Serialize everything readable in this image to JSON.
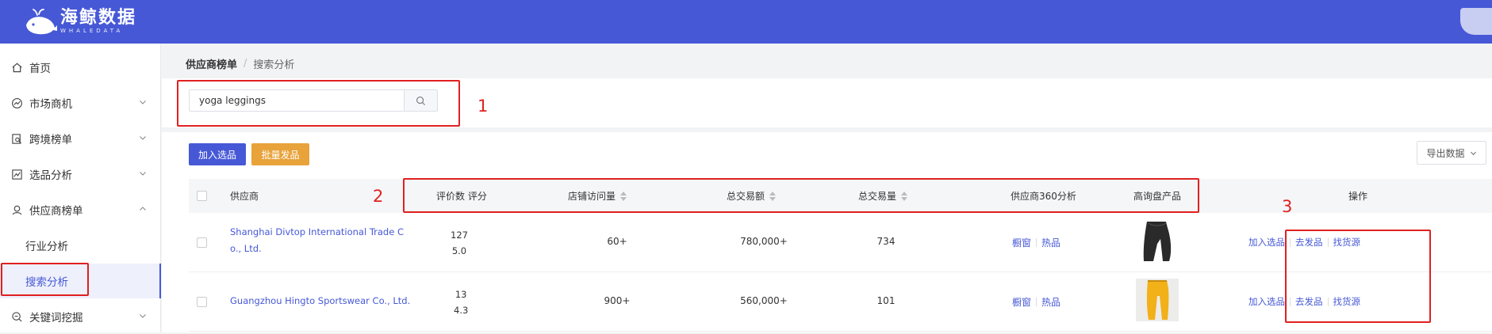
{
  "header": {
    "brand_cn": "海鲸数据",
    "brand_en": "WHALEDATA",
    "brand_color": "#4658d6"
  },
  "sidebar": {
    "items": [
      {
        "label": "首页",
        "icon": "home-icon"
      },
      {
        "label": "市场商机",
        "icon": "trend-icon"
      },
      {
        "label": "跨境榜单",
        "icon": "search-doc-icon"
      },
      {
        "label": "选品分析",
        "icon": "chart-icon"
      },
      {
        "label": "供应商榜单",
        "icon": "supplier-icon"
      },
      {
        "label": "行业分析"
      },
      {
        "label": "搜索分析"
      },
      {
        "label": "关键词挖掘",
        "icon": "keyword-icon"
      }
    ]
  },
  "breadcrumb": {
    "parent": "供应商榜单",
    "separator": "/",
    "current": "搜索分析"
  },
  "search": {
    "value": "yoga leggings"
  },
  "toolbar": {
    "add_label": "加入选品",
    "batch_label": "批量发品",
    "export_label": "导出数据"
  },
  "table": {
    "headers": {
      "supplier": "供应商",
      "reviews": "评价数 评分",
      "visits": "店铺访问量",
      "amount": "总交易额",
      "volume": "总交易量",
      "analysis360": "供应商360分析",
      "products": "高询盘产品",
      "actions": "操作"
    },
    "rows": [
      {
        "supplier_line1": "Shanghai Divtop International Trade C",
        "supplier_line2": "o., Ltd.",
        "reviews": "127",
        "rating": "5.0",
        "visits": "60+",
        "amount": "780,000+",
        "volume": "734",
        "window": "橱窗",
        "hot": "热品",
        "action_add": "加入选品",
        "action_publish": "去发品",
        "action_source": "找货源",
        "thumb_color": "#2a2a2a"
      },
      {
        "supplier_line1": "Guangzhou Hingto Sportswear Co., Ltd.",
        "supplier_line2": "",
        "reviews": "13",
        "rating": "4.3",
        "visits": "900+",
        "amount": "560,000+",
        "volume": "101",
        "window": "橱窗",
        "hot": "热品",
        "action_add": "加入选品",
        "action_publish": "去发品",
        "action_source": "找货源",
        "thumb_color": "#f2b019"
      }
    ]
  },
  "annotations": {
    "one": "1",
    "two": "2",
    "three": "3"
  }
}
